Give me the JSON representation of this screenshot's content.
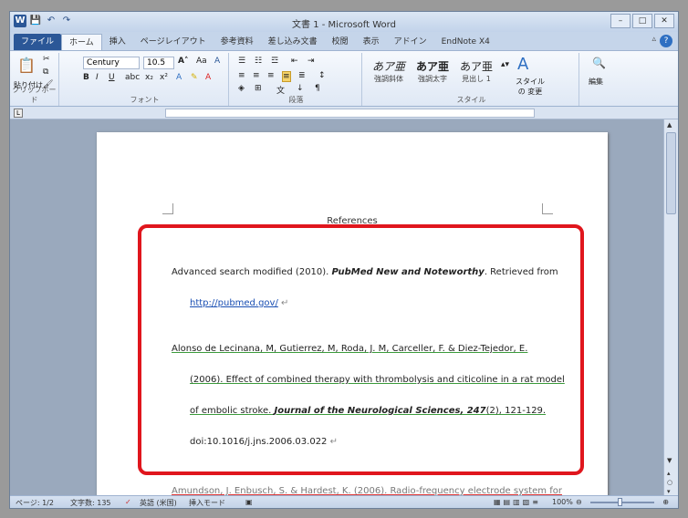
{
  "window": {
    "title": "文書 1 - Microsoft Word",
    "quick_access": [
      "W",
      "💾",
      "↶",
      "↷"
    ]
  },
  "tabs": [
    "ファイル",
    "ホーム",
    "挿入",
    "ページレイアウト",
    "参考資料",
    "差し込み文書",
    "校閲",
    "表示",
    "アドイン",
    "EndNote X4"
  ],
  "ribbon": {
    "clipboard": {
      "paste": "貼り付け",
      "label": "クリップボード"
    },
    "font": {
      "name": "Century",
      "size": "10.5",
      "label": "フォント"
    },
    "paragraph": {
      "label": "段落"
    },
    "styles": {
      "items": [
        {
          "preview": "あア亜",
          "name": "強調斜体"
        },
        {
          "preview": "あア亜",
          "name": "強調太字"
        },
        {
          "preview": "あア亜",
          "name": "見出し 1"
        }
      ],
      "change": "スタイルの 変更",
      "label": "スタイル"
    },
    "editing": {
      "label": "編集"
    }
  },
  "document": {
    "heading": "References",
    "line1_text": "Advanced search modified (2010). ",
    "line1_italic": "PubMed New and Noteworthy",
    "line1_tail": ". Retrieved from",
    "line2_link": "http://pubmed.gov/",
    "line3": "Alonso de Lecinana, M, Gutierrez, M, Roda, J. M, Carceller, F. & Diez-Tejedor, E.",
    "line4": "(2006). Effect of combined therapy with thrombolysis and citicoline in a rat model",
    "line5_text": "of embolic stroke. ",
    "line5_italic": "Journal of the Neurological Sciences, 247",
    "line5_tail": "(2), 121-129.",
    "line6": "doi:10.1016/j.jns.2006.03.022",
    "line7": "Amundson, J. Enbusch, S. & Hardest, K. (2006). Radio-frequency electrode system for",
    "para_mark": "↵"
  },
  "status": {
    "page": "ページ: 1/2",
    "words": "文字数: 135",
    "language": "英語 (米国)",
    "mode": "挿入モード",
    "zoom": "100%"
  }
}
